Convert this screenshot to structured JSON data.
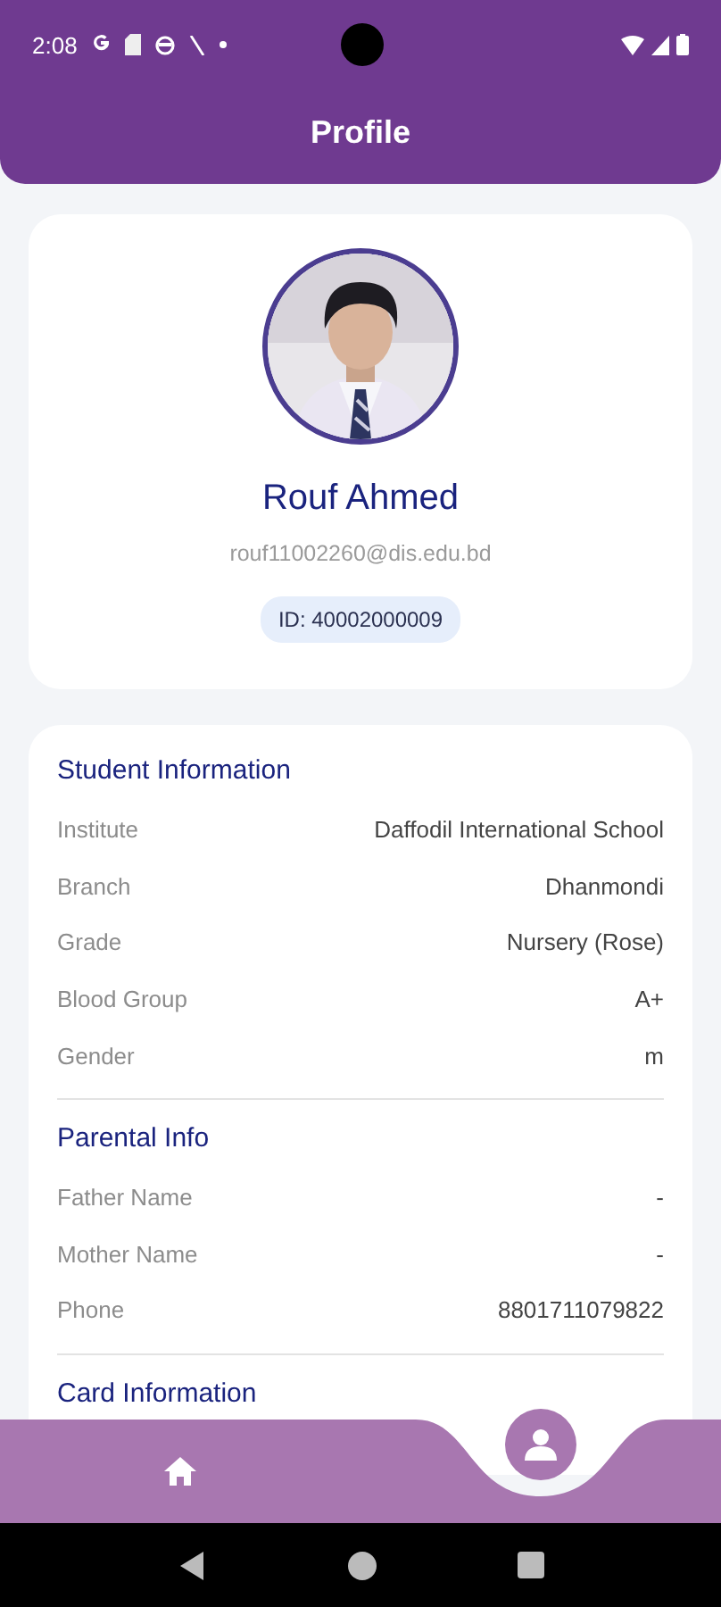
{
  "status_bar": {
    "time": "2:08"
  },
  "header": {
    "title": "Profile"
  },
  "profile": {
    "name": "Rouf Ahmed",
    "email": "rouf11002260@dis.edu.bd",
    "id_badge": "ID: 40002000009"
  },
  "sections": [
    {
      "title": "Student Information",
      "rows": [
        {
          "label": "Institute",
          "value": "Daffodil International School"
        },
        {
          "label": "Branch",
          "value": "Dhanmondi"
        },
        {
          "label": "Grade",
          "value": "Nursery (Rose)"
        },
        {
          "label": "Blood Group",
          "value": "A+"
        },
        {
          "label": "Gender",
          "value": "m"
        }
      ]
    },
    {
      "title": "Parental Info",
      "rows": [
        {
          "label": "Father Name",
          "value": "-"
        },
        {
          "label": "Mother Name",
          "value": "-"
        },
        {
          "label": "Phone",
          "value": "8801711079822"
        }
      ]
    },
    {
      "title": "Card Information"
    }
  ],
  "bottom_nav": [
    {
      "kind": "home",
      "selected": false
    },
    {
      "kind": "profile",
      "selected": true
    }
  ]
}
